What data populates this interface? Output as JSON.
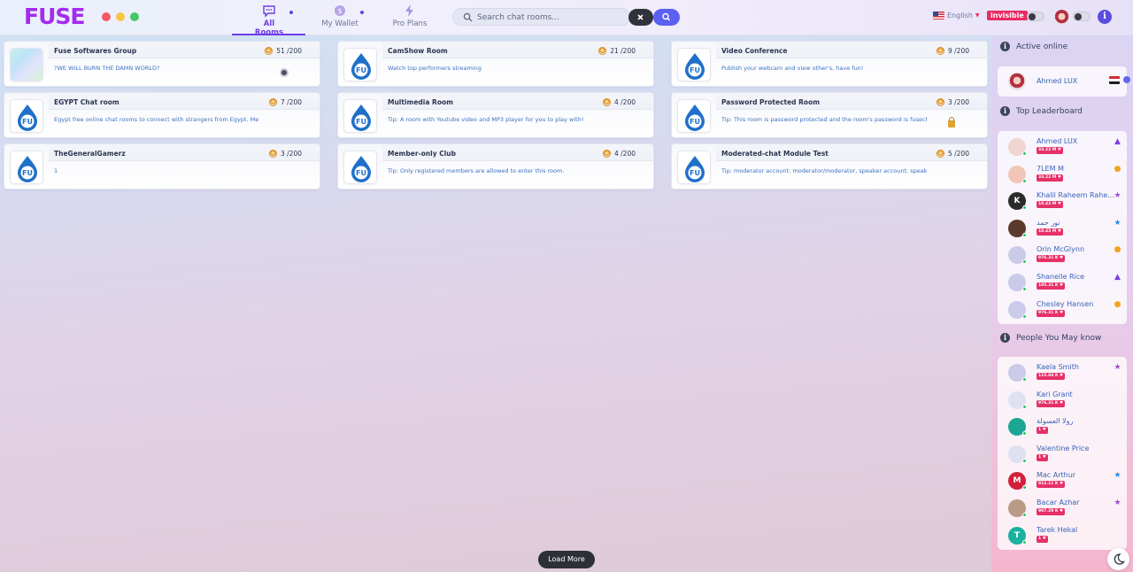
{
  "app": {
    "logo": "FUSE"
  },
  "nav": {
    "tabs": [
      {
        "label": "All Rooms",
        "icon": "chat-bubble-icon",
        "active": true
      },
      {
        "label": "My Wallet",
        "icon": "coin-icon",
        "active": false
      },
      {
        "label": "Pro Plans",
        "icon": "lightning-icon",
        "active": false
      }
    ]
  },
  "search": {
    "placeholder": "Search chat rooms...",
    "value": ""
  },
  "header": {
    "language": "English",
    "invisible_label": "invisible"
  },
  "rooms": [
    {
      "name": "Fuse Softwares Group",
      "count": "51 /200",
      "desc": "?WE WILL BURN THE DAMN WORLD?",
      "thumb": "pastel",
      "extra": "webcam-icon"
    },
    {
      "name": "CamShow Room",
      "count": "21 /200",
      "desc": "Watch top performers streaming",
      "thumb": "fu"
    },
    {
      "name": "Video Conference",
      "count": "9 /200",
      "desc": "Publish your webcam and view other's, have fun!",
      "thumb": "fu"
    },
    {
      "name": "EGYPT Chat room",
      "count": "7 /200",
      "desc": "Egypt free online chat rooms to connect with strangers from Egypt. Me",
      "thumb": "fu"
    },
    {
      "name": "Multimedia Room",
      "count": "4 /200",
      "desc": "Tip: A room with Youtube video and MP3 player for you to play with!",
      "thumb": "fu"
    },
    {
      "name": "Password Protected Room",
      "count": "3 /200",
      "desc": "Tip: This room is password protected and the room's password is fusech",
      "thumb": "fu",
      "extra": "lock-icon"
    },
    {
      "name": "TheGeneralGamerz",
      "count": "3 /200",
      "desc": "1",
      "thumb": "fu"
    },
    {
      "name": "Member-only Club",
      "count": "4 /200",
      "desc": "Tip: Only registered members are allowed to enter this room.",
      "thumb": "fu"
    },
    {
      "name": "Moderated-chat Module Test",
      "count": "5 /200",
      "desc": "Tip: moderator account: moderator/moderator, speaker account: speak",
      "thumb": "fu"
    }
  ],
  "active_online": {
    "title": "Active online",
    "users": [
      {
        "name": "Ahmed LUX"
      }
    ]
  },
  "leaderboard": {
    "title": "Top Leaderboard",
    "users": [
      {
        "name": "Ahmed LUX",
        "points": "33.22 M",
        "badge": "▲",
        "badge_color": "#7b3fe4",
        "avatar_bg": "#f0d6d2",
        "letter": ""
      },
      {
        "name": "7LEM M",
        "points": "33.22 M",
        "badge": "●",
        "badge_color": "#f0a224",
        "avatar_bg": "#f2c6b6",
        "letter": ""
      },
      {
        "name": "Khalil Raheem Rahe...",
        "points": "10.43 M",
        "badge": "★",
        "badge_color": "#a44fd6",
        "avatar_bg": "#2b2b2b",
        "letter": "K"
      },
      {
        "name": "نور حمد",
        "points": "10.43 M",
        "badge": "★",
        "badge_color": "#2e8de8",
        "avatar_bg": "#5b3a2e",
        "letter": ""
      },
      {
        "name": "Orin McGlynn",
        "points": "976.31 K",
        "badge": "●",
        "badge_color": "#f0a224",
        "avatar_bg": "#c9cbe8",
        "letter": ""
      },
      {
        "name": "Shanelle Rice",
        "points": "105.31 K",
        "badge": "▲",
        "badge_color": "#7b3fe4",
        "avatar_bg": "#c9cbe8",
        "letter": ""
      },
      {
        "name": "Chesley Hansen",
        "points": "976.31 K",
        "badge": "●",
        "badge_color": "#f0a224",
        "avatar_bg": "#c9cbe8",
        "letter": ""
      }
    ]
  },
  "people": {
    "title": "People You May know",
    "users": [
      {
        "name": "Kaela Smith",
        "points": "115.04 K",
        "badge": "★",
        "badge_color": "#a44fd6",
        "avatar_bg": "#c9cbe8",
        "letter": ""
      },
      {
        "name": "Kari Grant",
        "points": "976.31 K",
        "badge": "",
        "badge_color": "",
        "avatar_bg": "#dfe1f0",
        "letter": ""
      },
      {
        "name": "رولا العسولة",
        "points": "1",
        "badge": "",
        "badge_color": "",
        "avatar_bg": "#1aa894",
        "letter": ""
      },
      {
        "name": "Valentine Price",
        "points": "1",
        "badge": "",
        "badge_color": "",
        "avatar_bg": "#dfe1f0",
        "letter": ""
      },
      {
        "name": "Mac Arthur",
        "points": "912.11 K",
        "badge": "★",
        "badge_color": "#2e8de8",
        "avatar_bg": "#d2203a",
        "letter": "M"
      },
      {
        "name": "Bacar Azhar",
        "points": "907.29 K",
        "badge": "★",
        "badge_color": "#a44fd6",
        "avatar_bg": "#b89a86",
        "letter": ""
      },
      {
        "name": "Tarek Hekal",
        "points": "1",
        "badge": "",
        "badge_color": "",
        "avatar_bg": "#1ab3a0",
        "letter": "T"
      }
    ]
  },
  "footer": {
    "load_more": "Load More"
  }
}
